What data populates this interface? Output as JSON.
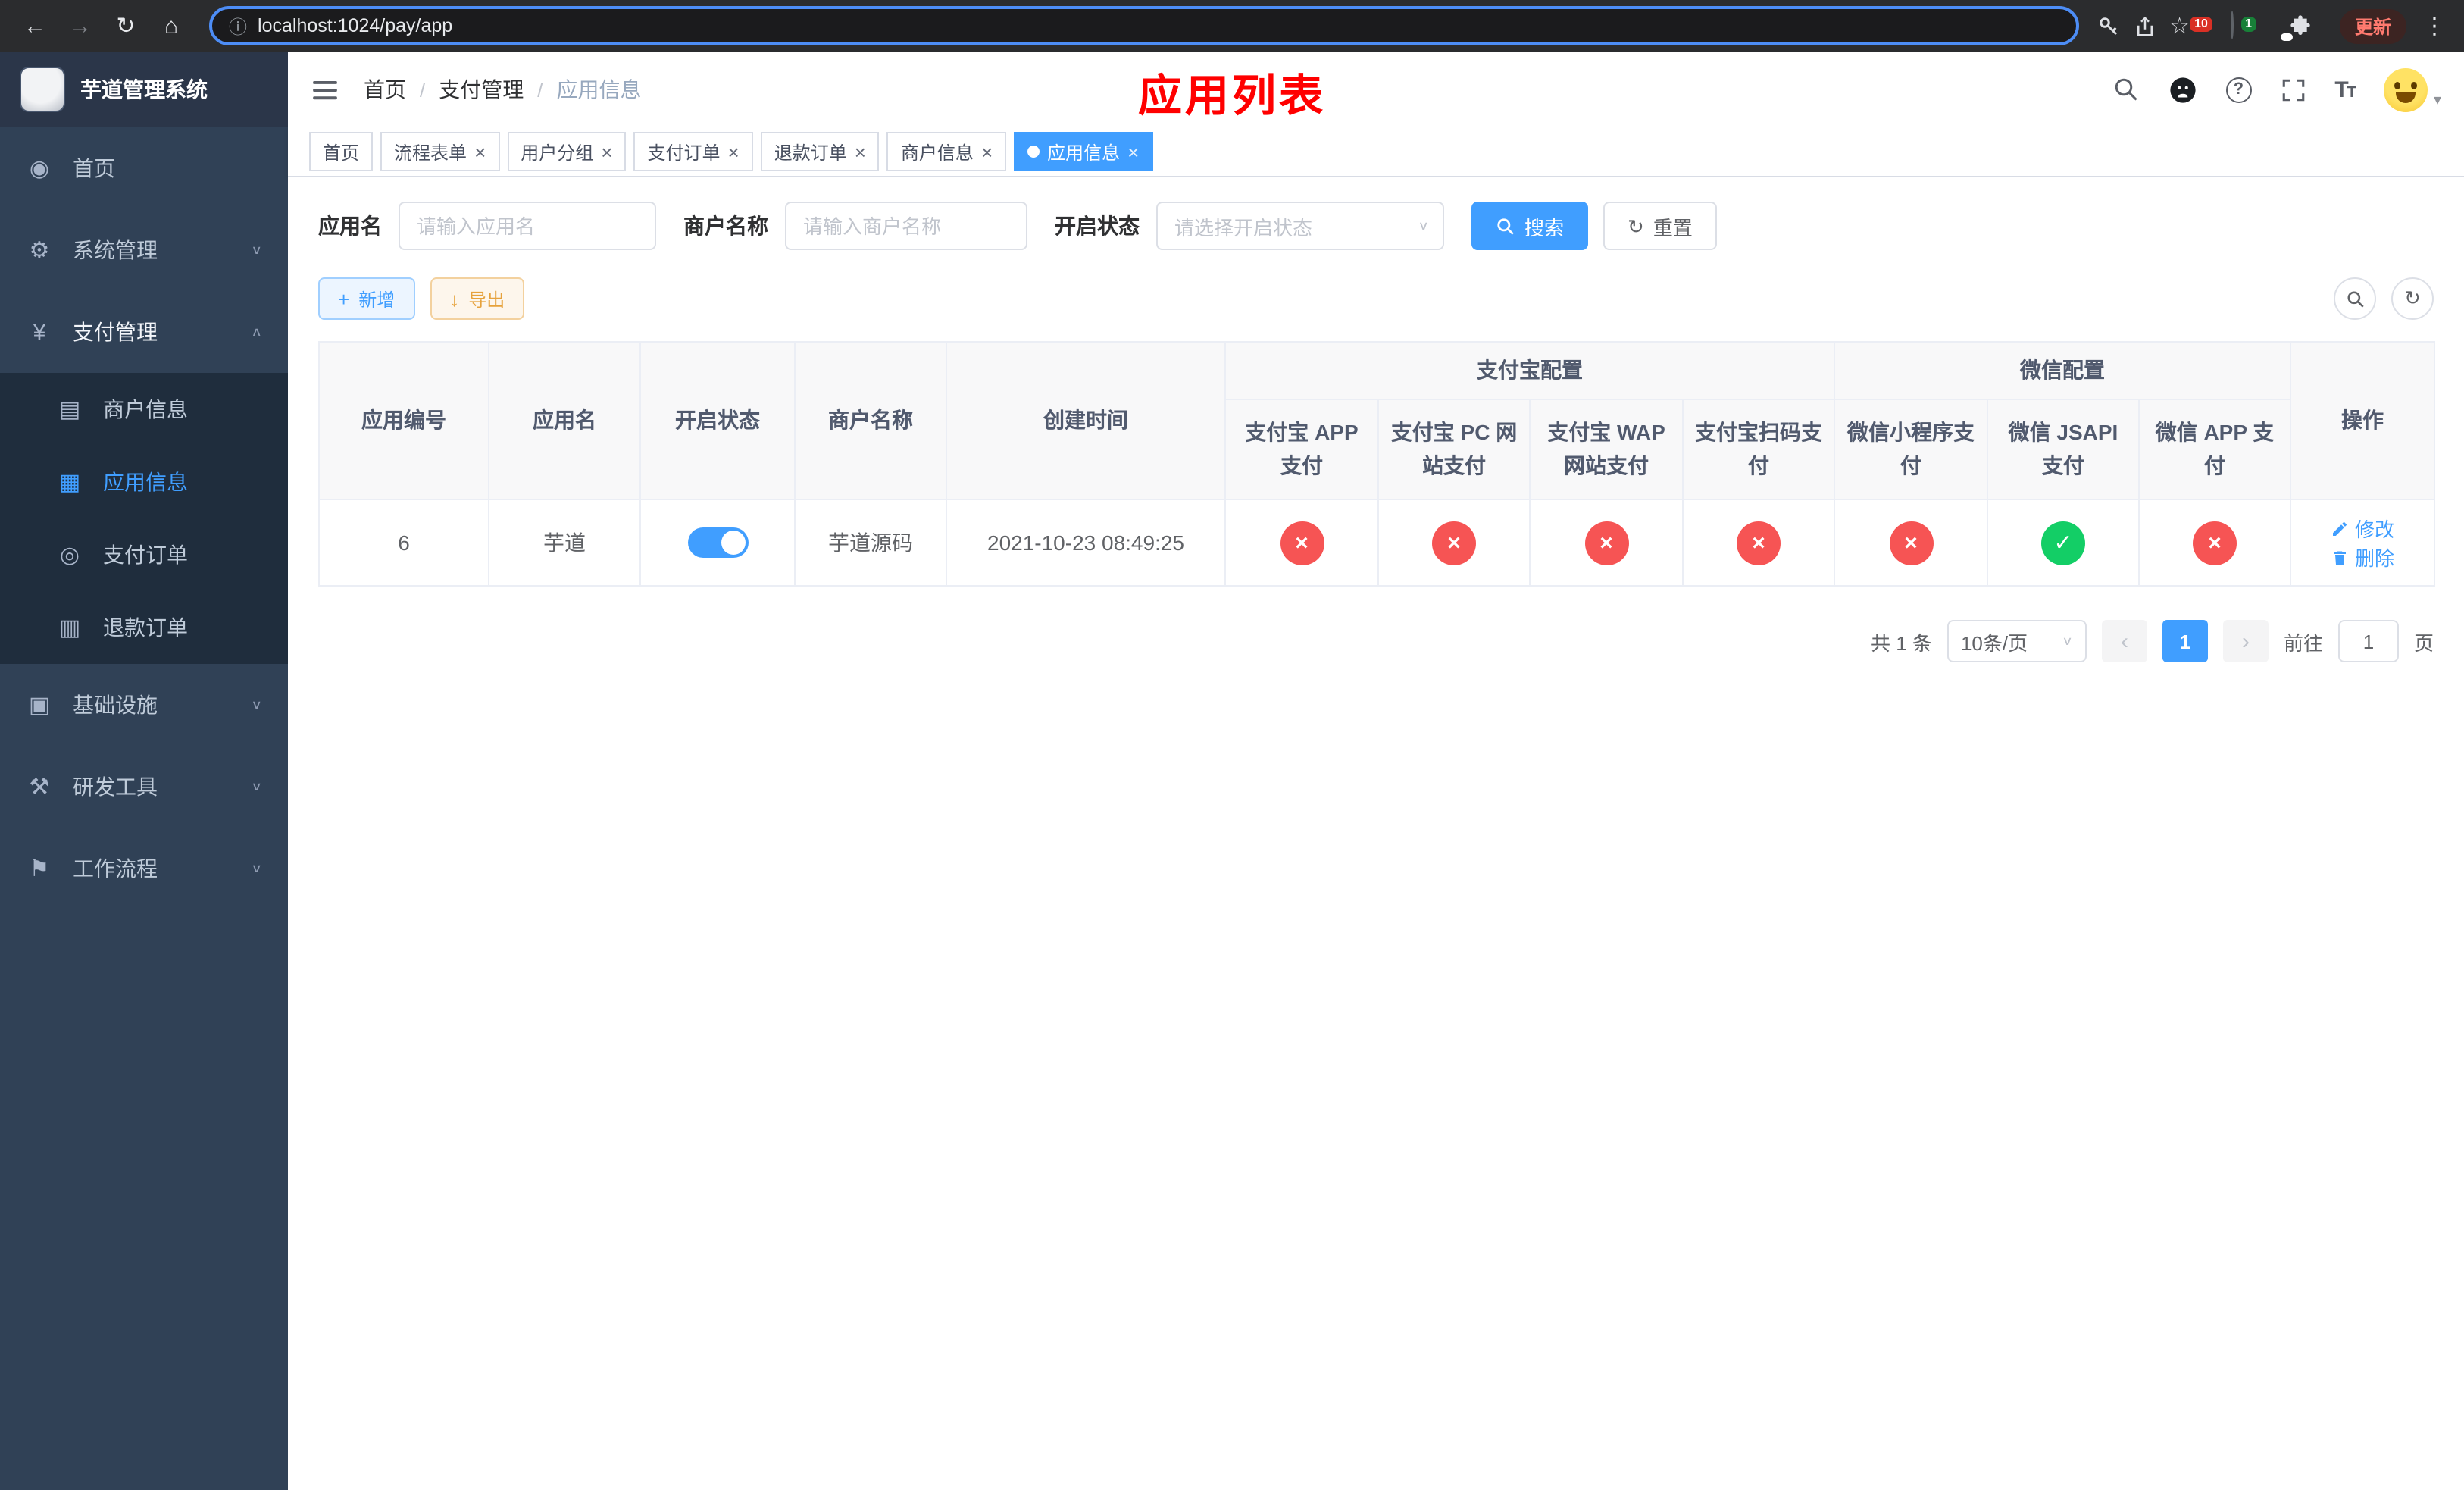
{
  "browser": {
    "url": "localhost:1024/pay/app",
    "update_label": "更新",
    "ext_badges": {
      "grid": "10",
      "colorful": "1"
    }
  },
  "icons": {
    "back": "←",
    "forward": "→",
    "reload": "↻",
    "home": "⌂",
    "info": "ⓘ",
    "star": "☆",
    "menu_dots": "⋮",
    "dashboard": "◉",
    "gear": "⚙",
    "yen": "¥",
    "merchant": "▤",
    "app_grid": "▦",
    "pay_order": "◎",
    "refund": "▥",
    "infra": "▣",
    "tools": "⚒",
    "workflow": "⚑",
    "chevron_down": "∨",
    "chevron_up": "∧",
    "select_caret": "∨",
    "close": "×",
    "check": "✓",
    "cross": "×",
    "plus": "+",
    "download": "↓",
    "refresh": "↻",
    "prev": "‹",
    "next": "›",
    "help": "?",
    "caret_small": "▾"
  },
  "sidebar": {
    "logo_title": "芋道管理系统",
    "items": [
      {
        "label": "首页"
      },
      {
        "label": "系统管理"
      },
      {
        "label": "支付管理"
      },
      {
        "label": "基础设施"
      },
      {
        "label": "研发工具"
      },
      {
        "label": "工作流程"
      }
    ],
    "payment_submenu": [
      {
        "label": "商户信息"
      },
      {
        "label": "应用信息"
      },
      {
        "label": "支付订单"
      },
      {
        "label": "退款订单"
      }
    ]
  },
  "header": {
    "breadcrumb": [
      "首页",
      "支付管理",
      "应用信息"
    ],
    "overlay_title": "应用列表"
  },
  "tabs": [
    {
      "label": "首页"
    },
    {
      "label": "流程表单"
    },
    {
      "label": "用户分组"
    },
    {
      "label": "支付订单"
    },
    {
      "label": "退款订单"
    },
    {
      "label": "商户信息"
    },
    {
      "label": "应用信息"
    }
  ],
  "filters": {
    "app_name": {
      "label": "应用名",
      "placeholder": "请输入应用名"
    },
    "merchant": {
      "label": "商户名称",
      "placeholder": "请输入商户名称"
    },
    "status": {
      "label": "开启状态",
      "placeholder": "请选择开启状态"
    },
    "search_label": "搜索",
    "reset_label": "重置"
  },
  "toolbar": {
    "add_label": "新增",
    "export_label": "导出"
  },
  "table": {
    "group_headers": {
      "alipay": "支付宝配置",
      "wechat": "微信配置"
    },
    "columns": [
      "应用编号",
      "应用名",
      "开启状态",
      "商户名称",
      "创建时间",
      "支付宝 APP 支付",
      "支付宝 PC 网站支付",
      "支付宝 WAP 网站支付",
      "支付宝扫码支付",
      "微信小程序支付",
      "微信 JSAPI 支付",
      "微信 APP 支付",
      "操作"
    ],
    "row": {
      "id": "6",
      "name": "芋道",
      "enabled": true,
      "merchant": "芋道源码",
      "created": "2021-10-23 08:49:25",
      "statuses": [
        {
          "column": "支付宝 APP 支付",
          "ok": false
        },
        {
          "column": "支付宝 PC 网站支付",
          "ok": false
        },
        {
          "column": "支付宝 WAP 网站支付",
          "ok": false
        },
        {
          "column": "支付宝扫码支付",
          "ok": false
        },
        {
          "column": "微信小程序支付",
          "ok": false
        },
        {
          "column": "微信 JSAPI 支付",
          "ok": true
        },
        {
          "column": "微信 APP 支付",
          "ok": false
        }
      ],
      "edit_label": "修改",
      "delete_label": "删除"
    }
  },
  "pagination": {
    "total": "共 1 条",
    "page_size": "10条/页",
    "current_page": "1",
    "goto_label": "前往",
    "goto_value": "1",
    "goto_unit": "页"
  }
}
